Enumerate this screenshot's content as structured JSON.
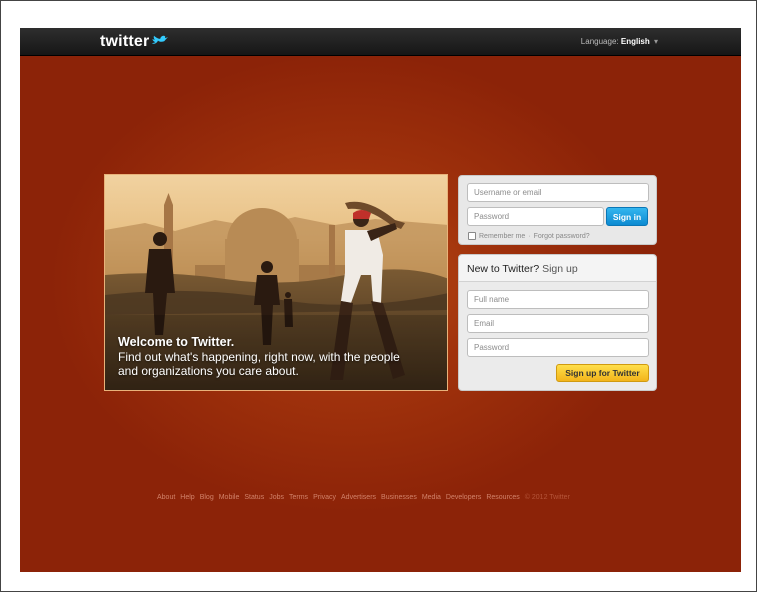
{
  "topbar": {
    "logo_text": "twitter",
    "language_label": "Language:",
    "language_value": "English"
  },
  "hero": {
    "title": "Welcome to Twitter.",
    "subtitle": "Find out what's happening, right now, with the people and organizations you care about."
  },
  "login": {
    "username_placeholder": "Username or email",
    "password_placeholder": "Password",
    "signin_label": "Sign in",
    "remember_label": "Remember me",
    "separator": "·",
    "forgot_label": "Forgot password?"
  },
  "signup": {
    "heading_strong": "New to Twitter?",
    "heading_link": "Sign up",
    "fullname_placeholder": "Full name",
    "email_placeholder": "Email",
    "password_placeholder": "Password",
    "button_label": "Sign up for Twitter"
  },
  "footer": {
    "links": [
      "About",
      "Help",
      "Blog",
      "Mobile",
      "Status",
      "Jobs",
      "Terms",
      "Privacy",
      "Advertisers",
      "Businesses",
      "Media",
      "Developers",
      "Resources"
    ],
    "copyright": "© 2012 Twitter"
  },
  "colors": {
    "background": "#8c2308",
    "signin_blue": "#0c8ad1",
    "signup_yellow": "#f3b41b"
  }
}
